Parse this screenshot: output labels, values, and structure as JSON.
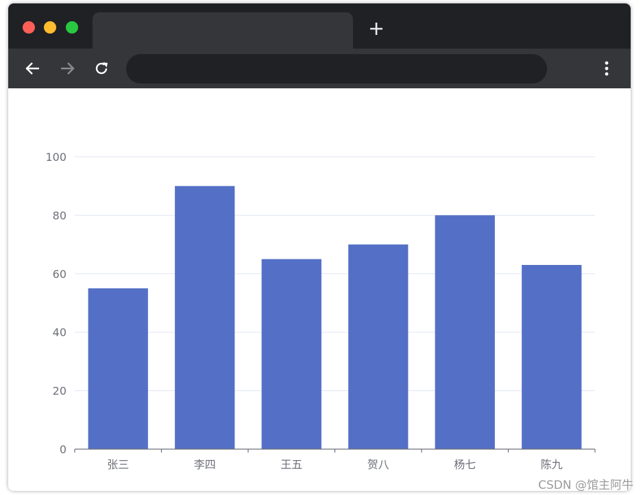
{
  "browser": {
    "tab_title": "",
    "address": "",
    "icons": {
      "close": "close-dot-icon",
      "minimize": "minimize-dot-icon",
      "maximize": "maximize-dot-icon",
      "new_tab": "plus-icon",
      "back": "arrow-left-icon",
      "forward": "arrow-right-icon",
      "reload": "reload-icon",
      "menu": "kebab-menu-icon"
    },
    "colors": {
      "close": "#ff5f57",
      "minimize": "#febc2e",
      "maximize": "#28c840",
      "tabbar": "#202124",
      "toolbar": "#35363a"
    }
  },
  "chart_data": {
    "type": "bar",
    "categories": [
      "张三",
      "李四",
      "王五",
      "贺八",
      "杨七",
      "陈九"
    ],
    "values": [
      55,
      90,
      65,
      70,
      80,
      63
    ],
    "ylim": [
      0,
      100
    ],
    "yticks": [
      0,
      20,
      40,
      60,
      80,
      100
    ],
    "grid": true,
    "bar_color": "#5470c6",
    "title": "",
    "xlabel": "",
    "ylabel": ""
  },
  "watermark": "CSDN @馆主阿牛"
}
